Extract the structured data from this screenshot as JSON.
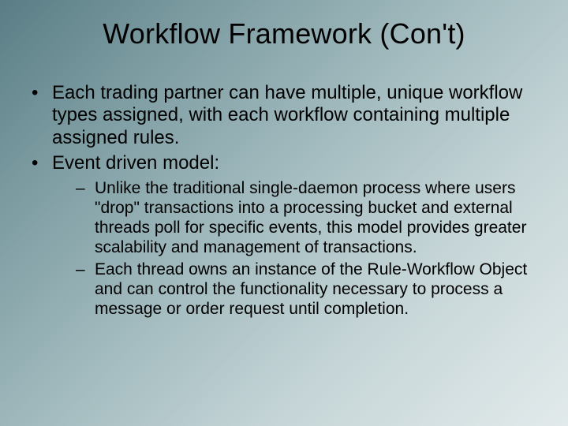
{
  "slide": {
    "title": "Workflow Framework (Con't)",
    "bullets": {
      "b1": "Each trading partner can have multiple, unique workflow types assigned, with each workflow containing multiple assigned rules.",
      "b2": "Event driven model:",
      "sub1": "Unlike the traditional single-daemon process where users \"drop\" transactions into a processing bucket and external threads poll for specific events, this model provides greater scalability and management of transactions.",
      "sub2": "Each thread owns an instance of the Rule-Workflow Object and can control the functionality necessary to process a message or order request until completion."
    }
  }
}
